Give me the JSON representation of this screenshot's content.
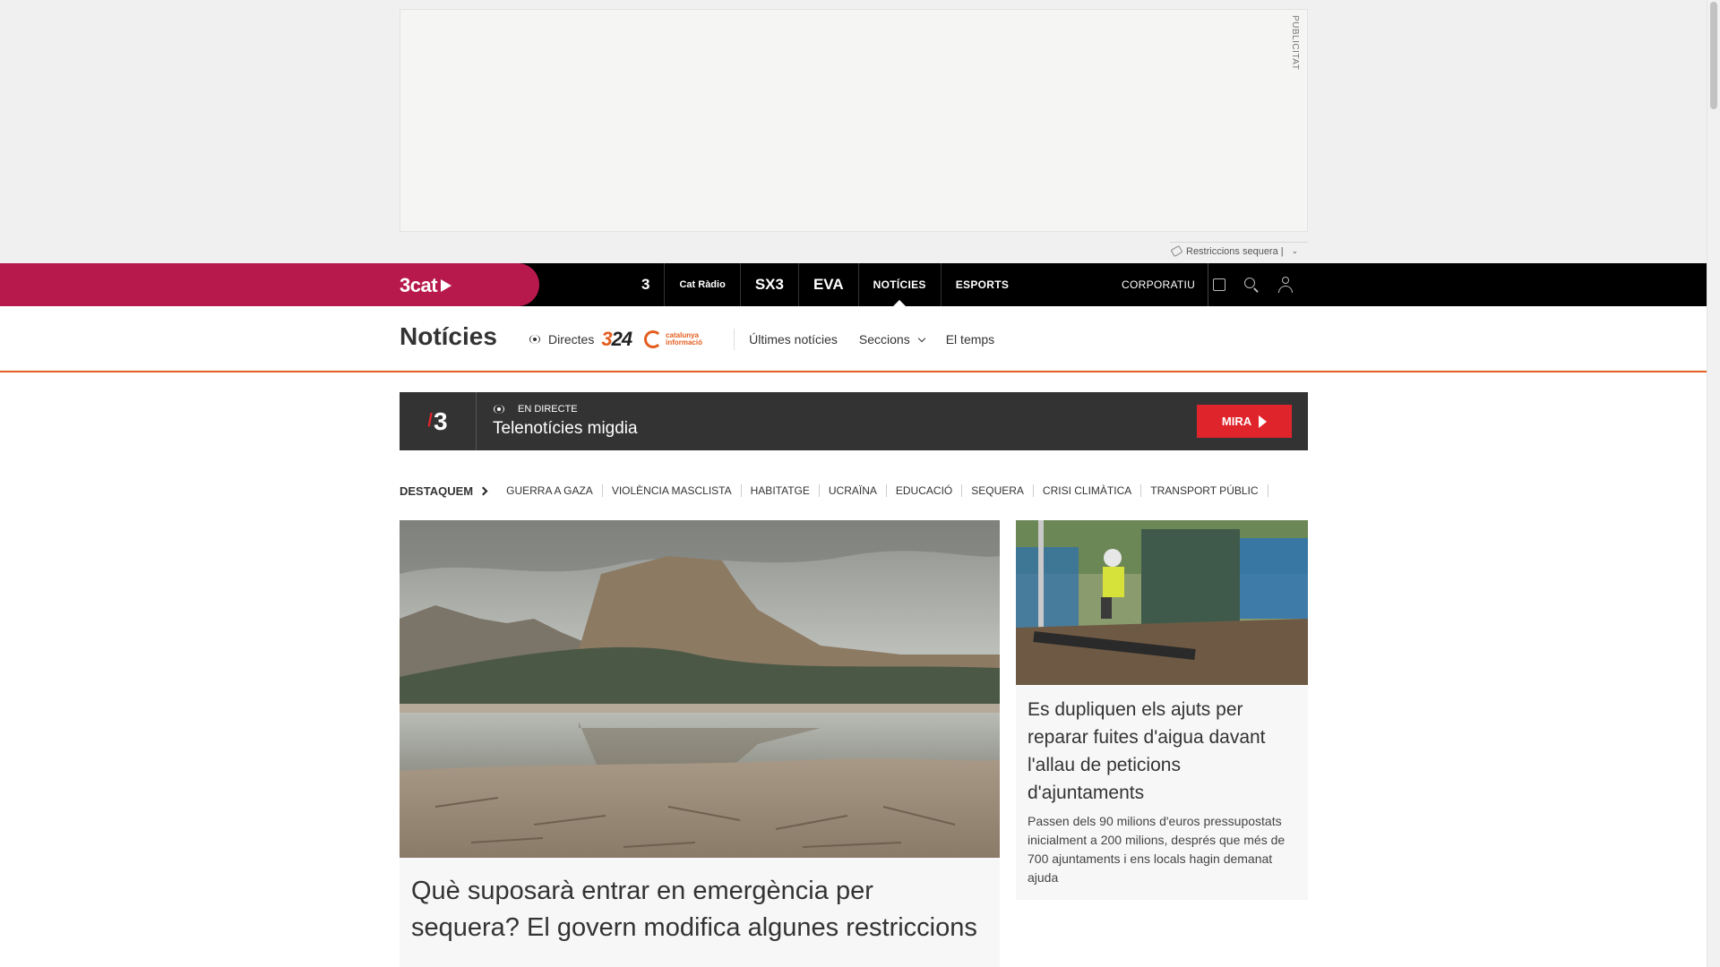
{
  "ad": {
    "label": "PUBLICITAT",
    "restrictions_label": "Restriccions sequera |"
  },
  "topbar": {
    "brand": "3cat",
    "channels": [
      "3",
      "Cat Ràdio",
      "SX3",
      "EVA"
    ],
    "nav": [
      "NOTÍCIES",
      "ESPORTS"
    ],
    "corporate": "CORPORATIU",
    "icons": [
      "shopping-bag-icon",
      "search-icon",
      "user-icon"
    ]
  },
  "section": {
    "title": "Notícies",
    "directes": "Directes",
    "logo_324_a": "3",
    "logo_324_b": "24",
    "logo_ci": "catalunya informació",
    "links": [
      "Últimes notícies",
      "Seccions",
      "El temps"
    ]
  },
  "live": {
    "channel": "3",
    "kicker": "EN DIRECTE",
    "title": "Telenotícies migdia",
    "button": "MIRA"
  },
  "topics": {
    "lead": "DESTAQUEM",
    "items": [
      "GUERRA A GAZA",
      "VIOLÈNCIA MASCLISTA",
      "HABITATGE",
      "UCRAÏNA",
      "EDUCACIÓ",
      "SEQUERA",
      "CRISI CLIMÀTICA",
      "TRANSPORT PÚBLIC"
    ]
  },
  "articles": {
    "main": {
      "title": "Què suposarà entrar en emergència per sequera? El govern modifica algunes restriccions"
    },
    "side": {
      "title": "Es dupliquen els ajuts per reparar fuites d'aigua davant l'allau de peticions d'ajuntaments",
      "summary": "Passen dels 90 milions d'euros pressupostats inicialment a 200 milions, després que més de 700 ajuntaments i ens locals hagin demanat ajuda"
    }
  },
  "colors": {
    "brand_band": "#b7194c",
    "accent_orange": "#e35d1f",
    "live_red": "#e0242b",
    "topbar": "#000000"
  }
}
